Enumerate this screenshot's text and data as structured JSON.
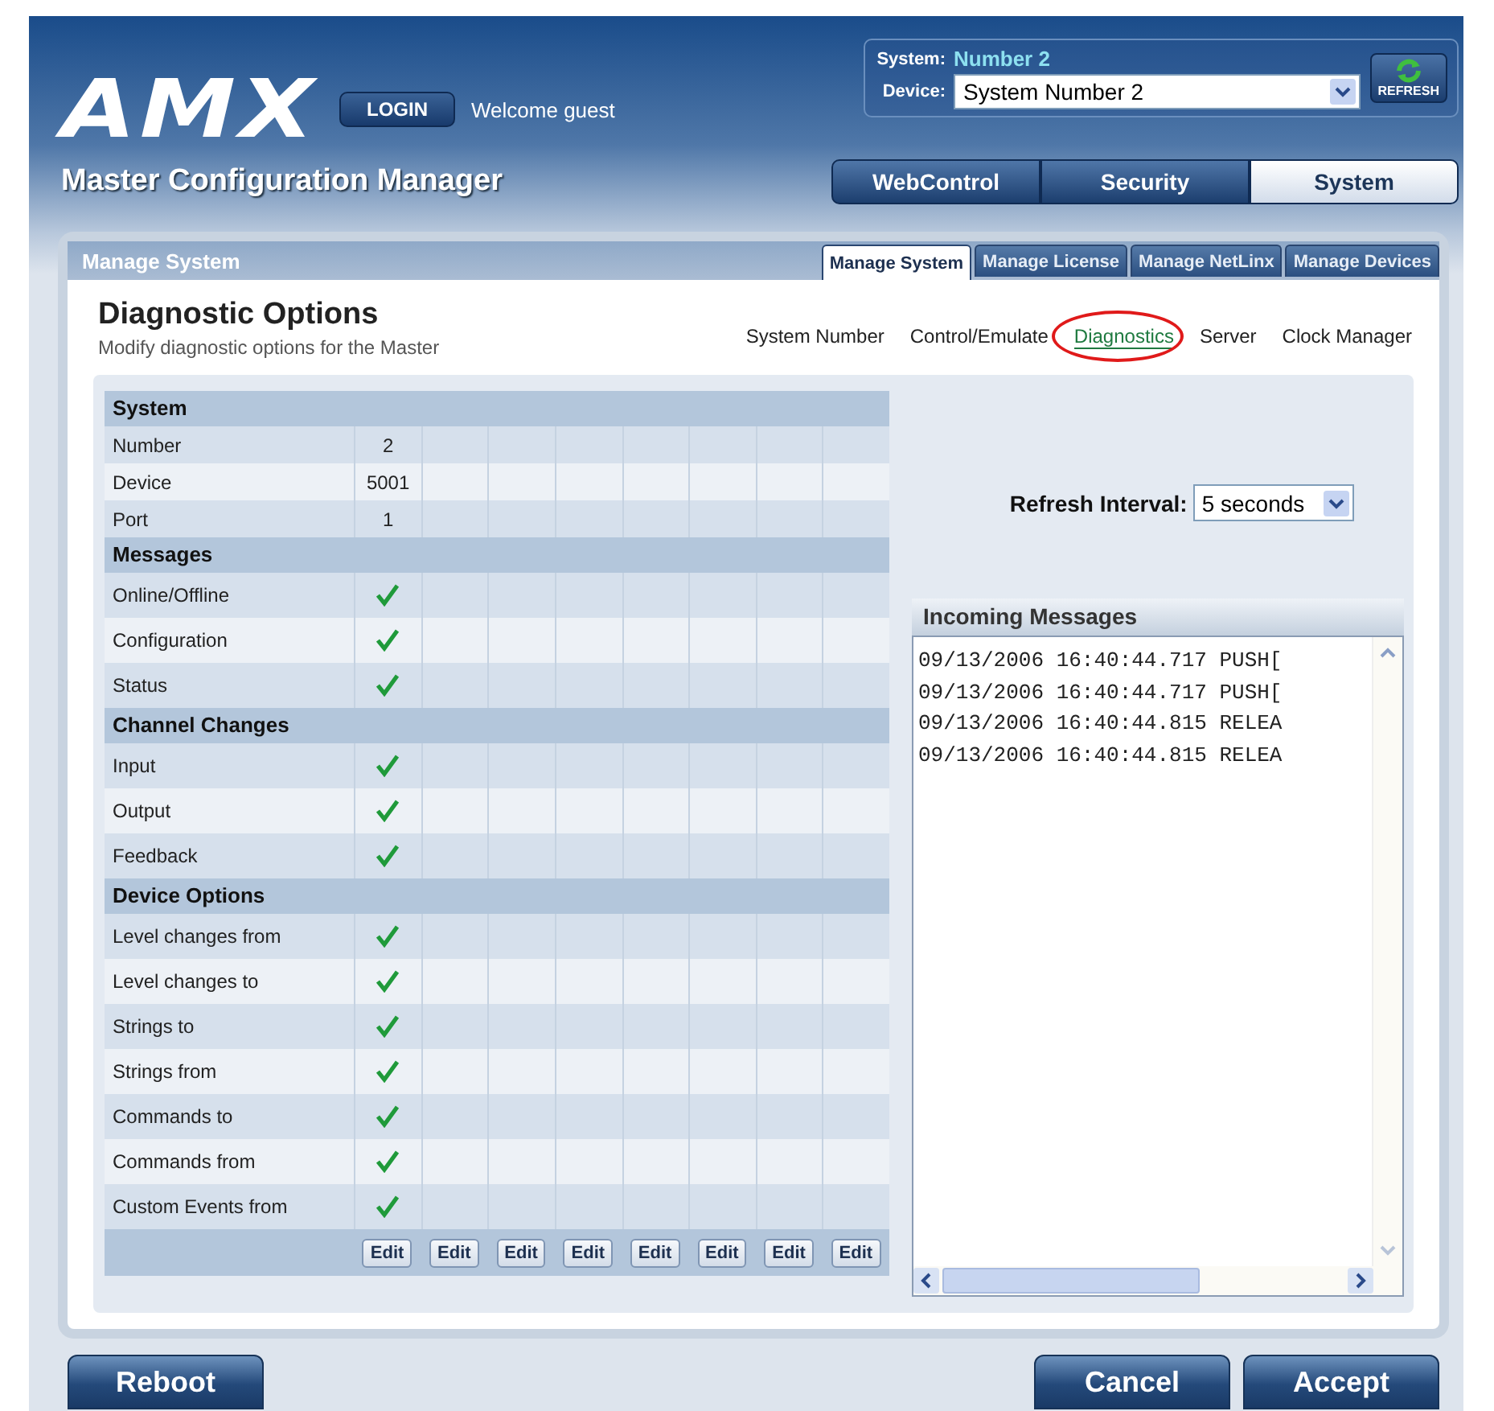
{
  "header": {
    "logo": "AMX",
    "login_button": "LOGIN",
    "welcome": "Welcome guest",
    "system_label": "System:",
    "system_value": "Number 2",
    "device_label": "Device:",
    "device_select": "System Number 2",
    "refresh_button": "REFRESH",
    "app_title": "Master Configuration Manager",
    "tabs": [
      {
        "label": "WebControl",
        "selected": false
      },
      {
        "label": "Security",
        "selected": false
      },
      {
        "label": "System",
        "selected": true
      }
    ]
  },
  "panel": {
    "title": "Manage System",
    "tabs": [
      {
        "label": "Manage System",
        "selected": true
      },
      {
        "label": "Manage License",
        "selected": false
      },
      {
        "label": "Manage NetLinx",
        "selected": false
      },
      {
        "label": "Manage Devices",
        "selected": false
      }
    ],
    "heading": "Diagnostic Options",
    "subheading": "Modify diagnostic options for the Master",
    "links": [
      {
        "label": "System Number",
        "selected": false
      },
      {
        "label": "Control/Emulate",
        "selected": false
      },
      {
        "label": "Diagnostics",
        "selected": true
      },
      {
        "label": "Server",
        "selected": false
      },
      {
        "label": "Clock Manager",
        "selected": false
      }
    ]
  },
  "table": {
    "sections": [
      {
        "title": "System",
        "rows": [
          {
            "label": "Number",
            "kind": "value",
            "value": "2"
          },
          {
            "label": "Device",
            "kind": "value",
            "value": "5001"
          },
          {
            "label": "Port",
            "kind": "value",
            "value": "1"
          }
        ]
      },
      {
        "title": "Messages",
        "rows": [
          {
            "label": "Online/Offline",
            "kind": "check",
            "checked": true
          },
          {
            "label": "Configuration",
            "kind": "check",
            "checked": true
          },
          {
            "label": "Status",
            "kind": "check",
            "checked": true
          }
        ]
      },
      {
        "title": "Channel Changes",
        "rows": [
          {
            "label": "Input",
            "kind": "check",
            "checked": true
          },
          {
            "label": "Output",
            "kind": "check",
            "checked": true
          },
          {
            "label": "Feedback",
            "kind": "check",
            "checked": true
          }
        ]
      },
      {
        "title": "Device Options",
        "rows": [
          {
            "label": "Level changes from",
            "kind": "check",
            "checked": true
          },
          {
            "label": "Level changes to",
            "kind": "check",
            "checked": true
          },
          {
            "label": "Strings to",
            "kind": "check",
            "checked": true
          },
          {
            "label": "Strings from",
            "kind": "check",
            "checked": true
          },
          {
            "label": "Commands to",
            "kind": "check",
            "checked": true
          },
          {
            "label": "Commands from",
            "kind": "check",
            "checked": true
          },
          {
            "label": "Custom Events from",
            "kind": "check",
            "checked": true
          }
        ]
      }
    ],
    "edit_buttons": [
      "Edit",
      "Edit",
      "Edit",
      "Edit",
      "Edit",
      "Edit",
      "Edit",
      "Edit"
    ]
  },
  "refresh": {
    "label": "Refresh Interval:",
    "value": "5 seconds"
  },
  "messages": {
    "title": "Incoming Messages",
    "lines": [
      "09/13/2006 16:40:44.717 PUSH[",
      "09/13/2006 16:40:44.717 PUSH[",
      "09/13/2006 16:40:44.815 RELEA",
      "09/13/2006 16:40:44.815 RELEA"
    ]
  },
  "footer": {
    "reboot": "Reboot",
    "cancel": "Cancel",
    "accept": "Accept"
  }
}
